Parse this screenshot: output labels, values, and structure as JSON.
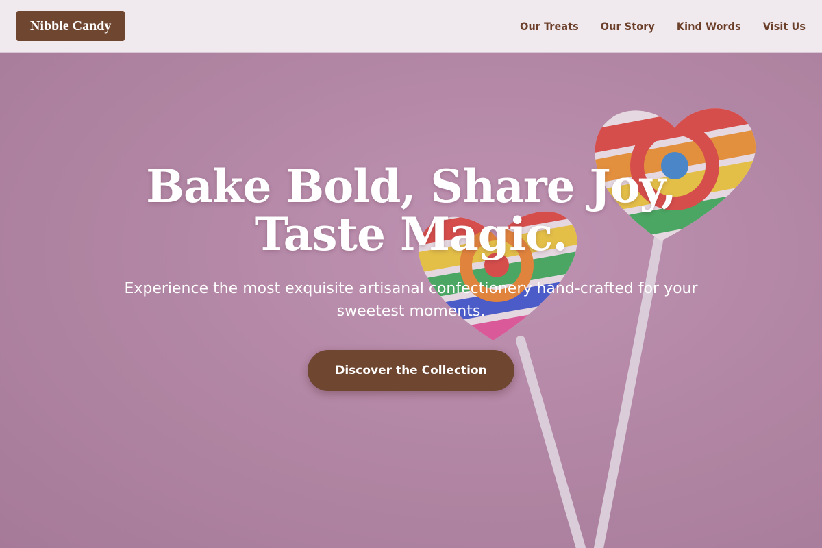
{
  "header": {
    "logo": "Nibble Candy",
    "nav": [
      {
        "label": "Our Treats"
      },
      {
        "label": "Our Story"
      },
      {
        "label": "Kind Words"
      },
      {
        "label": "Visit Us"
      }
    ]
  },
  "hero": {
    "headline_line1": "Bake Bold, Share Joy,",
    "headline_line2": "Taste Magic.",
    "subtext": "Experience the most exquisite artisanal confectionery hand-crafted for your sweetest moments.",
    "cta_label": "Discover the Collection"
  },
  "colors": {
    "brand_brown": "#6f4630",
    "nav_background": "#f0e9ee",
    "hero_background": "#b98fab",
    "nav_text": "#6b3f29"
  }
}
